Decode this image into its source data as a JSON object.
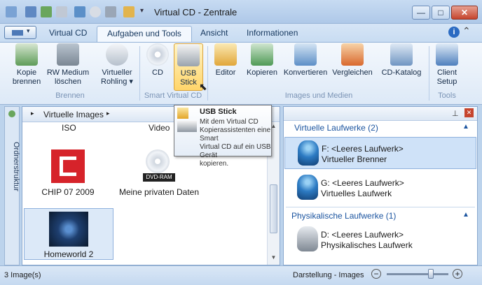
{
  "window": {
    "title": "Virtual CD - Zentrale"
  },
  "tabs": [
    "Virtual CD",
    "Aufgaben und Tools",
    "Ansicht",
    "Informationen"
  ],
  "ribbon": {
    "groups": {
      "brennen": "Brennen",
      "smart": "Smart Virtual CD",
      "images_medien": "Images und Medien",
      "tools": "Tools"
    },
    "buttons": {
      "kopie_brennen": [
        "Kopie",
        "brennen"
      ],
      "rw_medium": [
        "RW Medium",
        "löschen"
      ],
      "virtueller_rohling": [
        "Virtueller",
        "Rohling ▾"
      ],
      "cd": "CD",
      "usb_stick": [
        "USB",
        "Stick"
      ],
      "editor": "Editor",
      "kopieren": "Kopieren",
      "konvertieren": "Konvertieren",
      "vergleichen": "Vergleichen",
      "cd_katalog": "CD-Katalog",
      "client_setup": [
        "Client",
        "Setup"
      ]
    }
  },
  "side_strip": {
    "label": "Ordnerstruktur"
  },
  "left_pane": {
    "breadcrumb": "Virtuelle Images",
    "column_labels": [
      "ISO",
      "Video"
    ],
    "images": [
      {
        "name": "CHIP 07 2009",
        "icon": "chip-logo-icon"
      },
      {
        "name": "Meine privaten Daten",
        "icon": "dvd-ram-icon",
        "badge": "DVD-RAM"
      },
      {
        "name": "Homeworld 2",
        "icon": "homeworld-icon"
      }
    ]
  },
  "right_pane": {
    "group1_header": "Virtuelle Laufwerke (2)",
    "group1_header_visible": "e Laufwerke (2)",
    "drives_virtual": [
      {
        "line1": "F: <Leeres Laufwerk>",
        "line2": "Virtueller Brenner",
        "badge": "BD"
      },
      {
        "line1": "G: <Leeres Laufwerk>",
        "line2": "Virtuelles Laufwerk",
        "badge": "BD"
      }
    ],
    "group2_header": "Physikalische Laufwerke (1)",
    "drives_physical": [
      {
        "line1": "D: <Leeres Laufwerk>",
        "line2": "Physikalisches Laufwerk",
        "badge": "DVD"
      }
    ]
  },
  "tooltip": {
    "title": "USB Stick",
    "body_lines": [
      "Mit dem Virtual CD",
      "Kopierassistenten eine Smart",
      "Virtual CD auf ein USB Gerät",
      "kopieren."
    ]
  },
  "status": {
    "count": "3 Image(s)",
    "view_label": "Darstellung - Images",
    "zoom_level": 0.72
  },
  "colors": {
    "accent": "#1c55a0",
    "ribbon_bg": "#dde9f7",
    "selected": "#ffd56a",
    "chip_red": "#d6232a"
  }
}
